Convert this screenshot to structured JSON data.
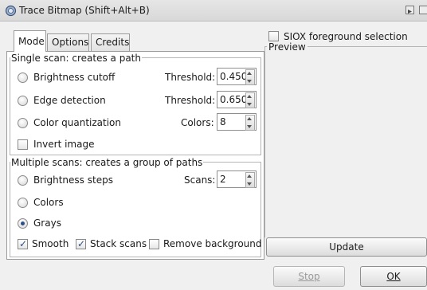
{
  "window": {
    "title": "Trace Bitmap (Shift+Alt+B)"
  },
  "tabs": [
    {
      "label": "Mode",
      "active": true
    },
    {
      "label": "Options",
      "active": false
    },
    {
      "label": "Credits",
      "active": false
    }
  ],
  "single_scan": {
    "legend": "Single scan: creates a path",
    "brightness": {
      "label": "Brightness cutoff",
      "checked": false,
      "field_label": "Threshold:",
      "value": "0.450"
    },
    "edge": {
      "label": "Edge detection",
      "checked": false,
      "field_label": "Threshold:",
      "value": "0.650"
    },
    "color_quant": {
      "label": "Color quantization",
      "checked": false,
      "field_label": "Colors:",
      "value": "8"
    },
    "invert": {
      "label": "Invert image",
      "checked": false
    }
  },
  "multiple_scans": {
    "legend": "Multiple scans: creates a group of paths",
    "brightness_steps": {
      "label": "Brightness steps",
      "checked": false,
      "field_label": "Scans:",
      "value": "2"
    },
    "colors": {
      "label": "Colors",
      "checked": false
    },
    "grays": {
      "label": "Grays",
      "checked": true
    },
    "smooth": {
      "label": "Smooth",
      "checked": true
    },
    "stack": {
      "label": "Stack scans",
      "checked": true
    },
    "remove_bg": {
      "label": "Remove background",
      "checked": false
    }
  },
  "siox": {
    "label": "SIOX foreground selection",
    "checked": false
  },
  "preview": {
    "legend": "Preview",
    "update_label": "Update"
  },
  "footer": {
    "stop_label": "Stop",
    "ok_label": "OK"
  },
  "icons": {
    "app": "inkscape-trace-icon",
    "menu": "panel-menu-icon",
    "close": "panel-close-icon",
    "accent": "#2d4e86"
  }
}
